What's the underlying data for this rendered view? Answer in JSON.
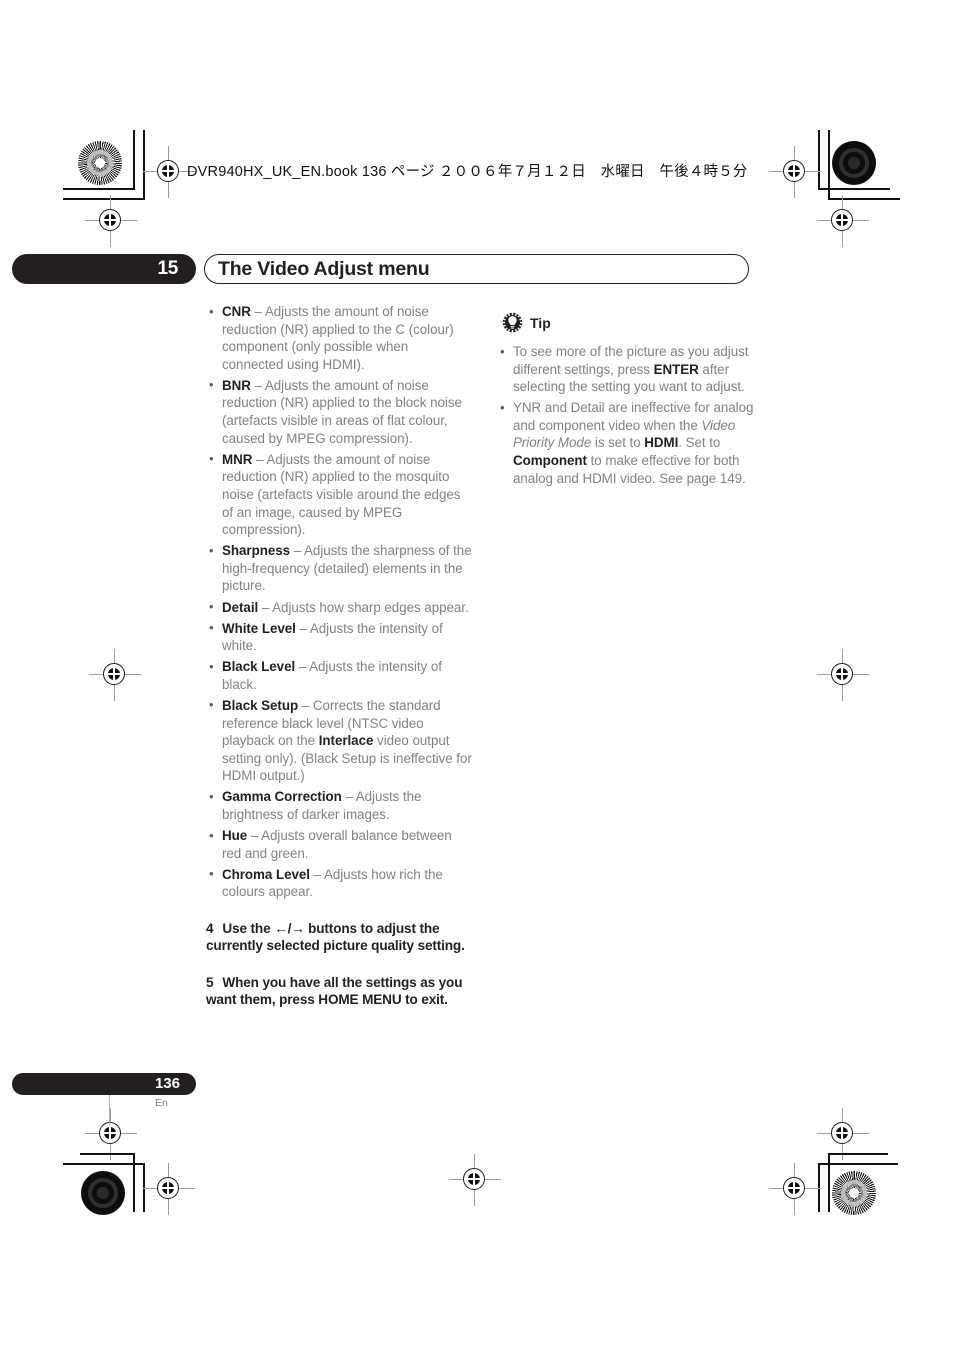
{
  "running_head": "DVR940HX_UK_EN.book  136 ページ  ２００６年７月１２日　水曜日　午後４時５分",
  "chapter": {
    "number": "15",
    "title": "The Video Adjust menu"
  },
  "left_column": {
    "bullets": [
      {
        "term": "CNR",
        "dash": " – ",
        "text": "Adjusts the amount of noise reduction (NR) applied to the C (colour) component (only possible when connected using HDMI)."
      },
      {
        "term": "BNR",
        "dash": " – ",
        "text": "Adjusts the amount of noise reduction (NR) applied to the block noise (artefacts visible in areas of flat colour, caused by MPEG compression)."
      },
      {
        "term": "MNR",
        "dash": " – ",
        "text": "Adjusts the amount of noise reduction (NR) applied to the mosquito noise (artefacts visible around the edges of an image, caused by MPEG compression)."
      },
      {
        "term": "Sharpness",
        "dash": " – ",
        "text": "Adjusts the sharpness of the high-frequency (detailed) elements in the picture."
      },
      {
        "term": "Detail",
        "dash": " – ",
        "text": "Adjusts how sharp edges appear."
      },
      {
        "term": "White Level",
        "dash": " – ",
        "text": "Adjusts the intensity of white."
      },
      {
        "term": "Black Level",
        "dash": " – ",
        "text": "Adjusts the intensity of black."
      },
      {
        "term": "Black Setup",
        "dash": " – ",
        "text_part1": "Corrects the standard reference black level (NTSC video playback on the ",
        "inline_bold": "Interlace",
        "text_part2": " video output setting only). (Black Setup is ineffective for HDMI output.)"
      },
      {
        "term": "Gamma Correction",
        "dash": " – ",
        "text": "Adjusts the brightness of darker images."
      },
      {
        "term": "Hue",
        "dash": " – ",
        "text": "Adjusts overall balance between red and green."
      },
      {
        "term": "Chroma Level",
        "dash": " – ",
        "text": "Adjusts how rich the colours appear."
      }
    ],
    "steps": [
      {
        "number": "4",
        "text_part1": "Use the ",
        "arrows": "←/→",
        "text_part2": " buttons to adjust the currently selected picture quality setting."
      },
      {
        "number": "5",
        "text_part1": "When you have all the settings as you want them, press HOME MENU to exit.",
        "arrows": "",
        "text_part2": ""
      }
    ]
  },
  "right_column": {
    "tip": {
      "icon": "lightbulb-tip-icon",
      "label": "Tip",
      "bullets": [
        {
          "text_part1": "To see more of the picture as you adjust different settings, press ",
          "bold1": "ENTER",
          "text_part2": " after selecting the setting you want to adjust."
        },
        {
          "text_part1": "YNR and Detail are ineffective for analog and component video when the ",
          "italic1": "Video Priority Mode",
          "text_part2": " is set to ",
          "bold1": "HDMI",
          "text_part3": ". Set to ",
          "bold2": "Component",
          "text_part4": " to make effective for both analog and HDMI video. See page 149."
        }
      ]
    }
  },
  "footer": {
    "page_number": "136",
    "language": "En"
  },
  "colors": {
    "ink_black": "#231f20",
    "body_gray": "#808285",
    "page_white": "#ffffff"
  }
}
